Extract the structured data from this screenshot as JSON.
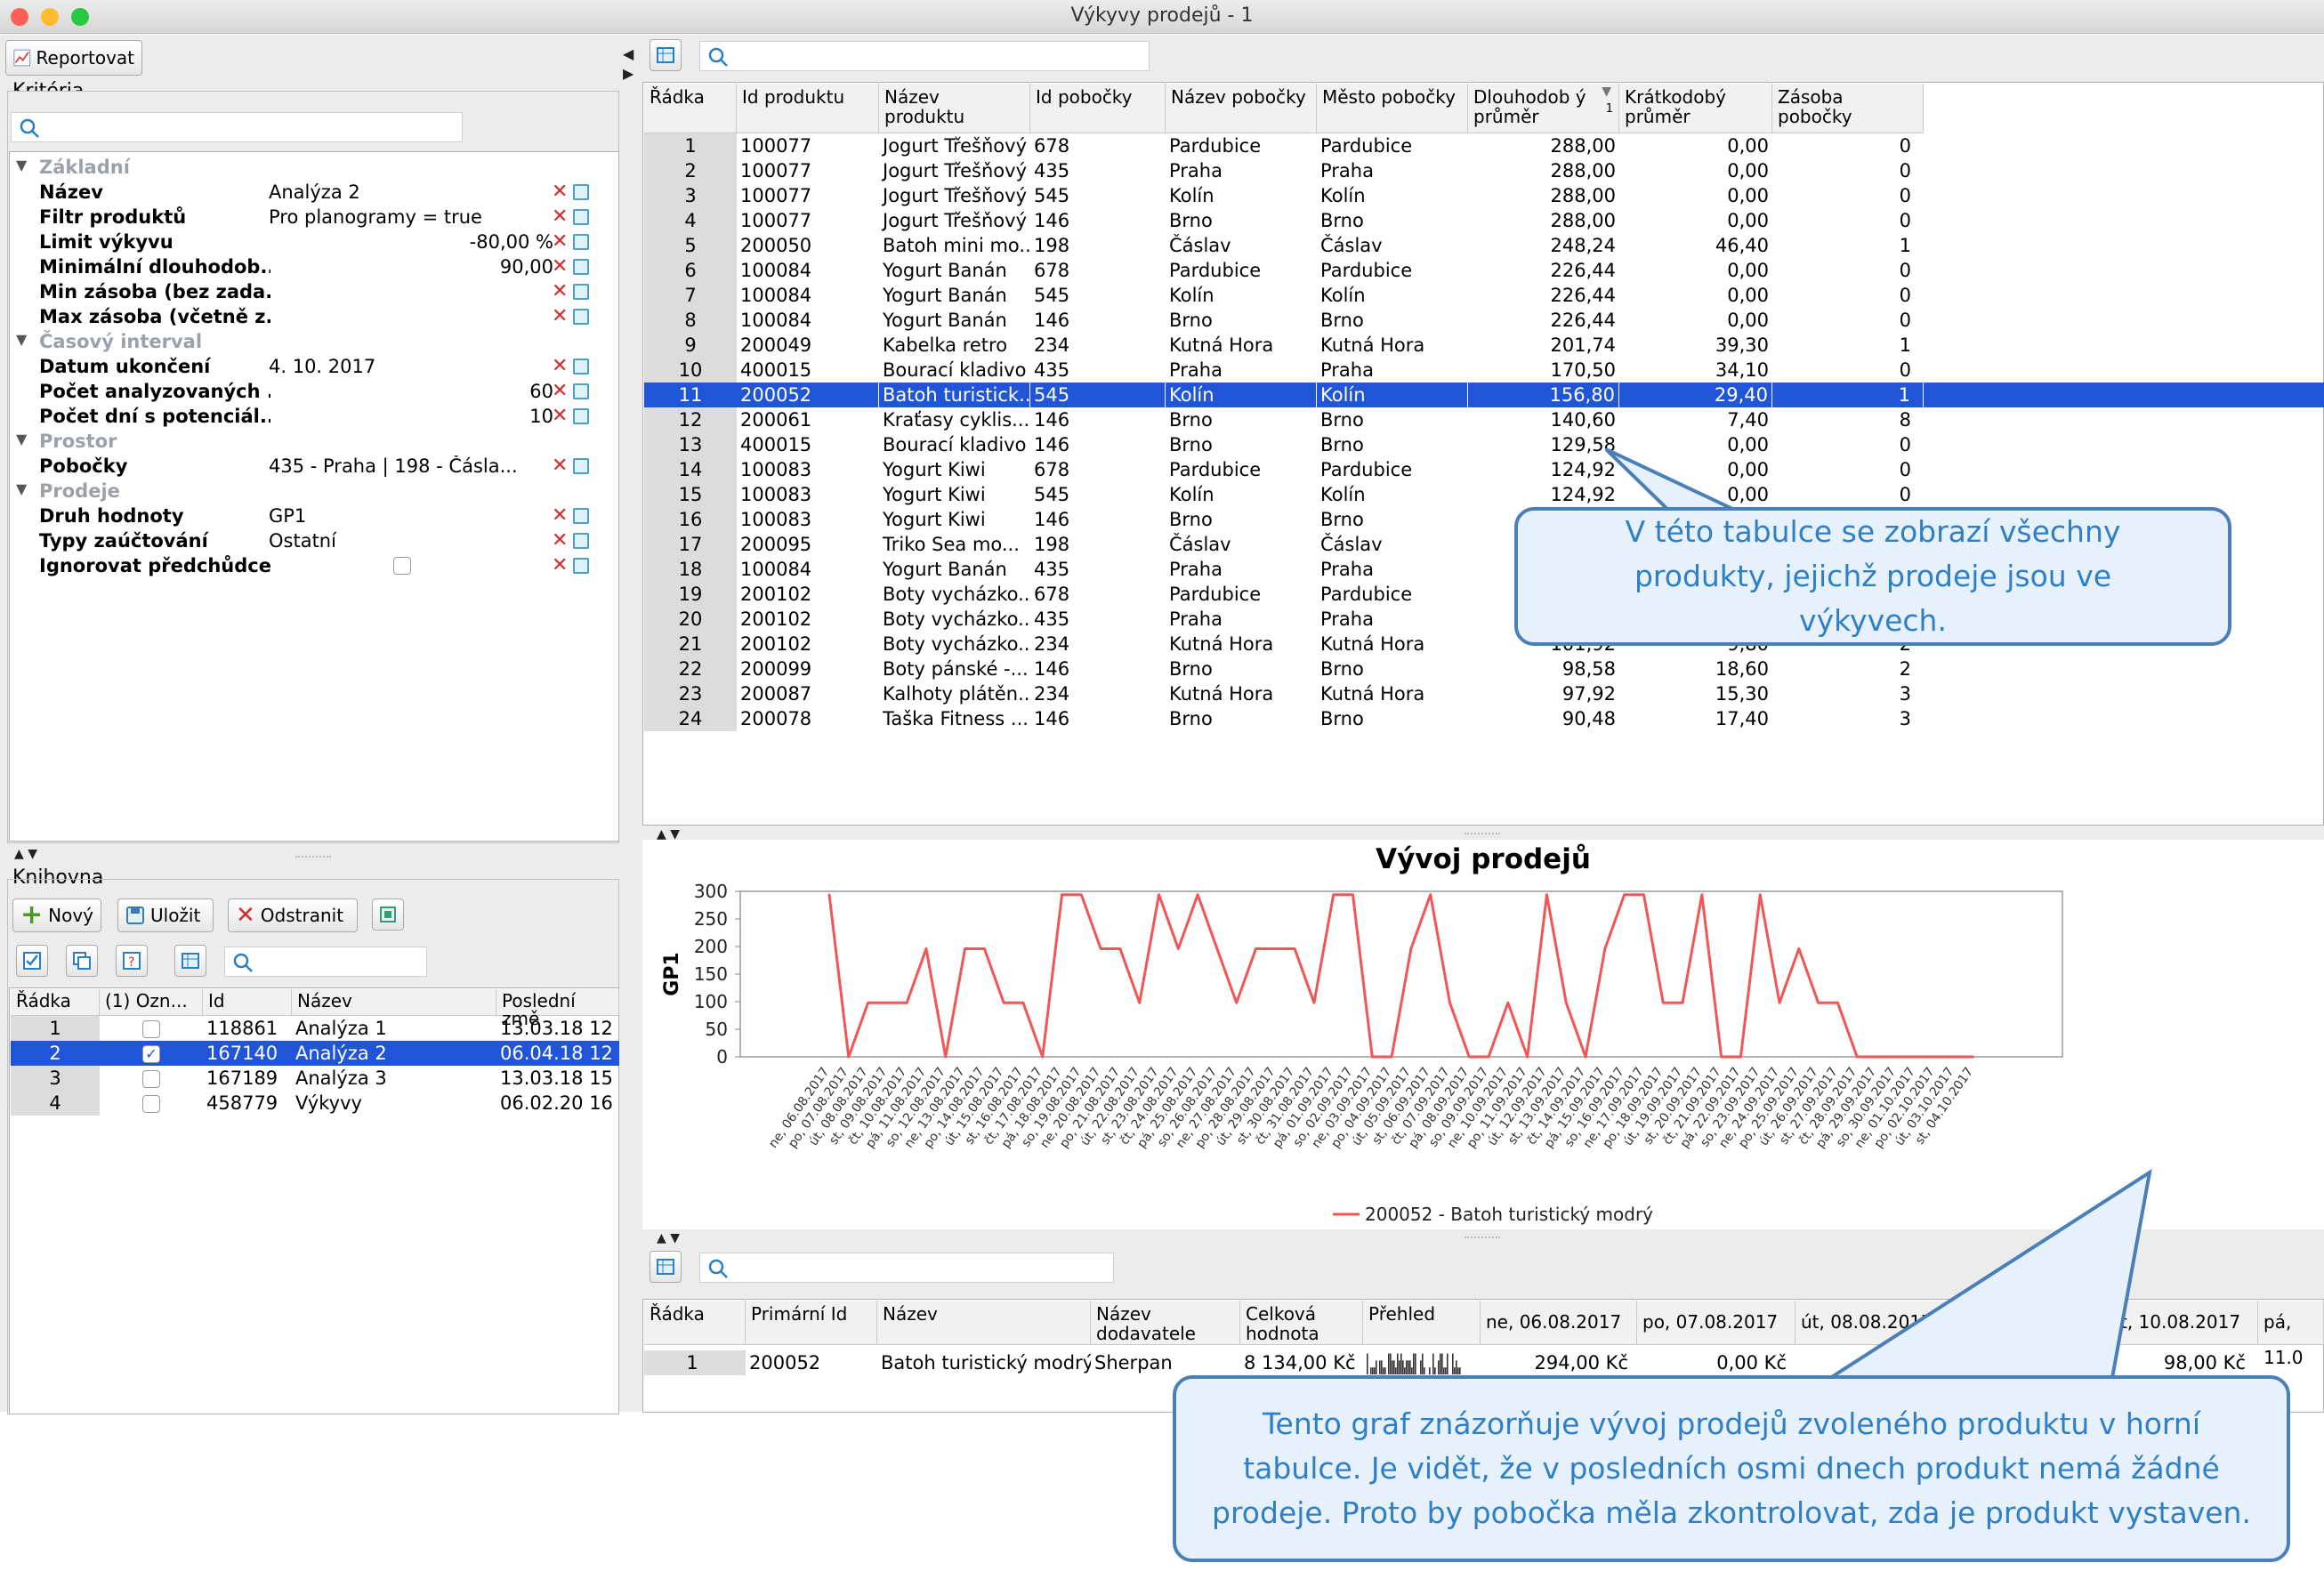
{
  "window": {
    "title": "Výkyvy prodejů - 1"
  },
  "toolbar": {
    "report_label": "Reportovat"
  },
  "criteria": {
    "title": "Kritéria",
    "groups": [
      {
        "label": "Základní",
        "rows": [
          {
            "label": "Název",
            "value": "Analýza 2"
          },
          {
            "label": "Filtr produktů",
            "value": "Pro planogramy = true"
          },
          {
            "label": "Limit výkyvu",
            "value": "-80,00 %"
          },
          {
            "label": "Minimální dlouhodob...",
            "value": "90,00"
          },
          {
            "label": "Min zásoba (bez zada...",
            "value": ""
          },
          {
            "label": "Max zásoba (včetně z...",
            "value": ""
          }
        ]
      },
      {
        "label": "Časový interval",
        "rows": [
          {
            "label": "Datum ukončení",
            "value": "4. 10. 2017"
          },
          {
            "label": "Počet analyzovaných ...",
            "value": "60"
          },
          {
            "label": "Počet dní s potenciál...",
            "value": "10"
          }
        ]
      },
      {
        "label": "Prostor",
        "rows": [
          {
            "label": "Pobočky",
            "value": "435 - Praha  | 198 - Čásla..."
          }
        ]
      },
      {
        "label": "Prodeje",
        "rows": [
          {
            "label": "Druh hodnoty",
            "value": "GP1"
          },
          {
            "label": "Typy zaúčtování",
            "value": "Ostatní"
          },
          {
            "label": "Ignorovat předchůdce...",
            "value": ""
          }
        ]
      }
    ]
  },
  "library": {
    "title": "Knihovna",
    "new_label": "Nový",
    "save_label": "Uložit",
    "delete_label": "Odstranit",
    "headers": [
      "Řádka",
      "(1) Ozn...",
      "Id",
      "Název",
      "Poslední změ"
    ],
    "rows": [
      {
        "n": "1",
        "checked": false,
        "id": "118861",
        "name": "Analýza 1",
        "changed": "13.03.18 12"
      },
      {
        "n": "2",
        "checked": true,
        "id": "167140",
        "name": "Analýza 2",
        "changed": "06.04.18 12"
      },
      {
        "n": "3",
        "checked": false,
        "id": "167189",
        "name": "Analýza 3",
        "changed": "13.03.18 15"
      },
      {
        "n": "4",
        "checked": false,
        "id": "458779",
        "name": "Výkyvy",
        "changed": "06.02.20 16"
      }
    ]
  },
  "main_table": {
    "headers": [
      "Řádka",
      "Id produktu",
      "Název produktu",
      "Id pobočky",
      "Název pobočky",
      "Město pobočky",
      "Dlouhodob ý průměr",
      "Krátkodobý průměr",
      "Zásoba pobočky"
    ],
    "sort_indicator": "1",
    "selected_index": 10,
    "rows": [
      [
        "1",
        "100077",
        "Jogurt Třešňový",
        "678",
        "Pardubice",
        "Pardubice",
        "288,00",
        "0,00",
        "0"
      ],
      [
        "2",
        "100077",
        "Jogurt Třešňový",
        "435",
        "Praha",
        "Praha",
        "288,00",
        "0,00",
        "0"
      ],
      [
        "3",
        "100077",
        "Jogurt Třešňový",
        "545",
        "Kolín",
        "Kolín",
        "288,00",
        "0,00",
        "0"
      ],
      [
        "4",
        "100077",
        "Jogurt Třešňový",
        "146",
        "Brno",
        "Brno",
        "288,00",
        "0,00",
        "0"
      ],
      [
        "5",
        "200050",
        "Batoh mini mo...",
        "198",
        "Čáslav",
        "Čáslav",
        "248,24",
        "46,40",
        "1"
      ],
      [
        "6",
        "100084",
        "Yogurt Banán",
        "678",
        "Pardubice",
        "Pardubice",
        "226,44",
        "0,00",
        "0"
      ],
      [
        "7",
        "100084",
        "Yogurt Banán",
        "545",
        "Kolín",
        "Kolín",
        "226,44",
        "0,00",
        "0"
      ],
      [
        "8",
        "100084",
        "Yogurt Banán",
        "146",
        "Brno",
        "Brno",
        "226,44",
        "0,00",
        "0"
      ],
      [
        "9",
        "200049",
        "Kabelka retro",
        "234",
        "Kutná Hora",
        "Kutná Hora",
        "201,74",
        "39,30",
        "1"
      ],
      [
        "10",
        "400015",
        "Bourací kladivo",
        "435",
        "Praha",
        "Praha",
        "170,50",
        "34,10",
        "0"
      ],
      [
        "11",
        "200052",
        "Batoh turistick...",
        "545",
        "Kolín",
        "Kolín",
        "156,80",
        "29,40",
        "1"
      ],
      [
        "12",
        "200061",
        "Kraťasy cyklis...",
        "146",
        "Brno",
        "Brno",
        "140,60",
        "7,40",
        "8"
      ],
      [
        "13",
        "400015",
        "Bourací kladivo",
        "146",
        "Brno",
        "Brno",
        "129,58",
        "0,00",
        "0"
      ],
      [
        "14",
        "100083",
        "Yogurt Kiwi",
        "678",
        "Pardubice",
        "Pardubice",
        "124,92",
        "0,00",
        "0"
      ],
      [
        "15",
        "100083",
        "Yogurt Kiwi",
        "545",
        "Kolín",
        "Kolín",
        "124,92",
        "0,00",
        "0"
      ],
      [
        "16",
        "100083",
        "Yogurt Kiwi",
        "146",
        "Brno",
        "Brno",
        "",
        "",
        ""
      ],
      [
        "17",
        "200095",
        "Triko Sea mo...",
        "198",
        "Čáslav",
        "Čáslav",
        "",
        "",
        ""
      ],
      [
        "18",
        "100084",
        "Yogurt Banán",
        "435",
        "Praha",
        "Praha",
        "",
        "",
        ""
      ],
      [
        "19",
        "200102",
        "Boty vycházko...",
        "678",
        "Pardubice",
        "Pardubice",
        "",
        "",
        ""
      ],
      [
        "20",
        "200102",
        "Boty vycházko...",
        "435",
        "Praha",
        "Praha",
        "",
        "",
        ""
      ],
      [
        "21",
        "200102",
        "Boty vycházko...",
        "234",
        "Kutná Hora",
        "Kutná Hora",
        "101,92",
        "9,80",
        "2"
      ],
      [
        "22",
        "200099",
        "Boty pánské -...",
        "146",
        "Brno",
        "Brno",
        "98,58",
        "18,60",
        "2"
      ],
      [
        "23",
        "200087",
        "Kalhoty plátěn...",
        "234",
        "Kutná Hora",
        "Kutná Hora",
        "97,92",
        "15,30",
        "3"
      ],
      [
        "24",
        "200078",
        "Taška Fitness ...",
        "146",
        "Brno",
        "Brno",
        "90,48",
        "17,40",
        "3"
      ]
    ]
  },
  "callout_table": "V této tabulce se zobrazí všechny produkty, jejichž prodeje jsou ve výkyvech.",
  "callout_chart": "Tento graf znázorňuje vývoj prodejů zvoleného produktu v horní tabulce. Je vidět, že v posledních osmi dnech produkt nemá žádné prodeje. Proto by pobočka měla zkontrolovat, zda je produkt vystaven.",
  "chart_data": {
    "type": "line",
    "title": "Vývoj prodejů",
    "ylabel": "GP1",
    "xlabel": "",
    "ylim": [
      0,
      300
    ],
    "yticks": [
      0,
      50,
      100,
      150,
      200,
      250,
      300
    ],
    "grid": false,
    "legend_position": "bottom",
    "series_color": "#f25555",
    "x": [
      "ne, 06.08.2017",
      "po, 07.08.2017",
      "út, 08.08.2017",
      "st, 09.08.2017",
      "čt, 10.08.2017",
      "pá, 11.08.2017",
      "so, 12.08.2017",
      "ne, 13.08.2017",
      "po, 14.08.2017",
      "út, 15.08.2017",
      "st, 16.08.2017",
      "čt, 17.08.2017",
      "pá, 18.08.2017",
      "so, 19.08.2017",
      "ne, 20.08.2017",
      "po, 21.08.2017",
      "út, 22.08.2017",
      "st, 23.08.2017",
      "čt, 24.08.2017",
      "pá, 25.08.2017",
      "so, 26.08.2017",
      "ne, 27.08.2017",
      "po, 28.08.2017",
      "út, 29.08.2017",
      "st, 30.08.2017",
      "čt, 31.08.2017",
      "pá, 01.09.2017",
      "so, 02.09.2017",
      "ne, 03.09.2017",
      "po, 04.09.2017",
      "út, 05.09.2017",
      "st, 06.09.2017",
      "čt, 07.09.2017",
      "pá, 08.09.2017",
      "so, 09.09.2017",
      "ne, 10.09.2017",
      "po, 11.09.2017",
      "út, 12.09.2017",
      "st, 13.09.2017",
      "čt, 14.09.2017",
      "pá, 15.09.2017",
      "so, 16.09.2017",
      "ne, 17.09.2017",
      "po, 18.09.2017",
      "út, 19.09.2017",
      "st, 20.09.2017",
      "čt, 21.09.2017",
      "pá, 22.09.2017",
      "so, 23.09.2017",
      "ne, 24.09.2017",
      "po, 25.09.2017",
      "út, 26.09.2017",
      "st, 27.09.2017",
      "čt, 28.09.2017",
      "pá, 29.09.2017",
      "so, 30.09.2017",
      "ne, 01.10.2017",
      "po, 02.10.2017",
      "út, 03.10.2017",
      "st, 04.10.2017"
    ],
    "series": [
      {
        "name": "200052 - Batoh turistický modrý",
        "values": [
          294,
          0,
          98,
          98,
          98,
          196,
          0,
          196,
          196,
          98,
          98,
          0,
          294,
          294,
          196,
          196,
          98,
          294,
          196,
          294,
          196,
          98,
          196,
          196,
          196,
          98,
          294,
          294,
          0,
          0,
          196,
          294,
          98,
          0,
          0,
          98,
          0,
          294,
          98,
          0,
          196,
          294,
          294,
          98,
          98,
          294,
          0,
          0,
          294,
          98,
          196,
          98,
          98,
          0,
          0,
          0,
          0,
          0,
          0,
          0
        ]
      }
    ]
  },
  "detail": {
    "headers": [
      "Řádka",
      "Primární Id",
      "Název",
      "Název dodavatele",
      "Celková hodnota",
      "Přehled",
      "ne, 06.08.2017",
      "po, 07.08.2017",
      "út, 08.08.2017",
      "čt, 10.08.2017",
      "pá, 11.0"
    ],
    "row": {
      "n": "1",
      "id": "200052",
      "name": "Batoh turistický modrý",
      "supplier": "Sherpan",
      "total": "8 134,00 Kč",
      "d1": "294,00 Kč",
      "d2": "0,00 Kč",
      "d4": "98,00 Kč"
    }
  }
}
